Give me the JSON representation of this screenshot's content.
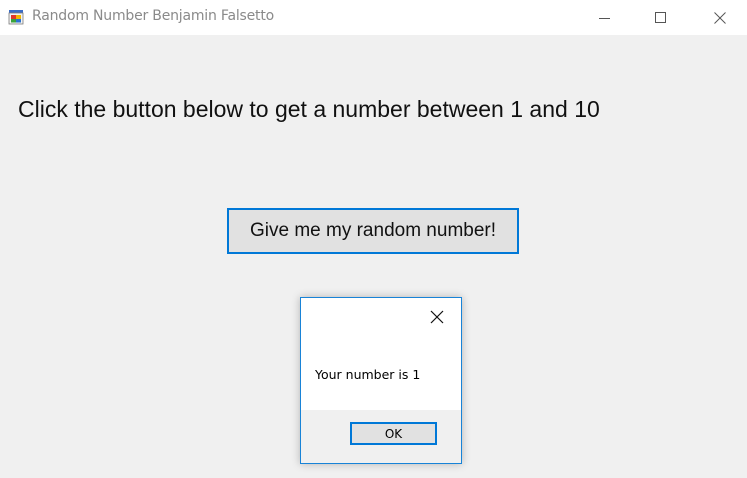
{
  "window": {
    "title": "Random Number Benjamin Falsetto",
    "icon": "windows-form-app-icon",
    "controls": {
      "minimize_icon": "minimize-icon",
      "maximize_icon": "maximize-icon",
      "close_icon": "close-icon"
    }
  },
  "main": {
    "instruction": "Click the button below to get a number between 1 and 10",
    "random_button_label": "Give me my random number!"
  },
  "dialog": {
    "close_icon": "close-icon",
    "message": "Your number is 1",
    "ok_label": "OK"
  },
  "colors": {
    "accent": "#0078d7",
    "background": "#f0f0f0",
    "button_face": "#e1e1e1"
  }
}
